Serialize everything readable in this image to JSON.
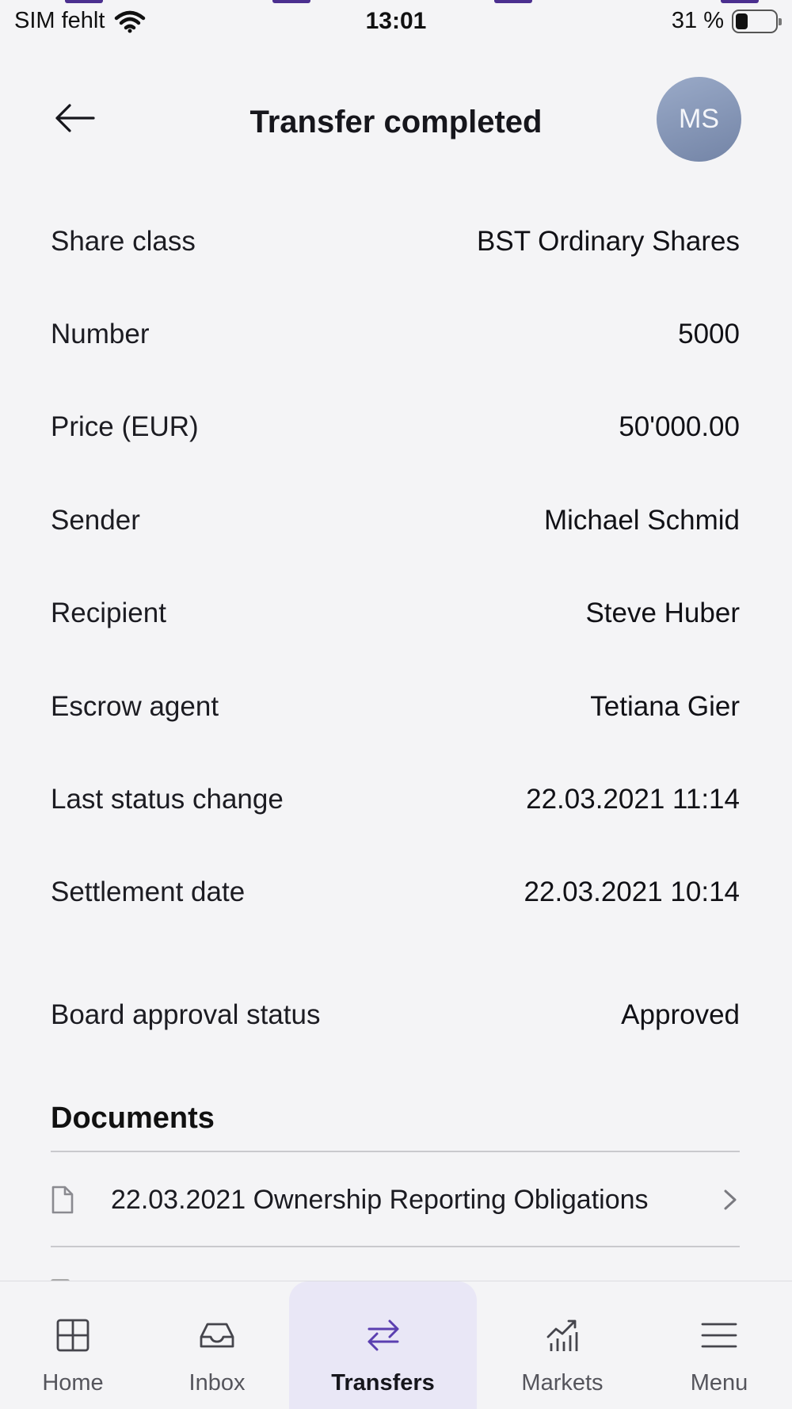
{
  "status_bar": {
    "carrier": "SIM fehlt",
    "time": "13:01",
    "battery_text": "31 %",
    "battery_level": 0.31,
    "wifi_icon": "wifi-icon"
  },
  "header": {
    "title": "Transfer completed",
    "back_icon": "arrow-left-icon",
    "avatar_initials": "MS"
  },
  "details": [
    {
      "label": "Share class",
      "value": "BST Ordinary Shares"
    },
    {
      "label": "Number",
      "value": "5000"
    },
    {
      "label": "Price (EUR)",
      "value": "50'000.00"
    },
    {
      "label": "Sender",
      "value": "Michael Schmid"
    },
    {
      "label": "Recipient",
      "value": "Steve Huber"
    },
    {
      "label": "Escrow agent",
      "value": "Tetiana Gier"
    },
    {
      "label": "Last status change",
      "value": "22.03.2021 11:14"
    },
    {
      "label": "Settlement date",
      "value": "22.03.2021 10:14"
    },
    {
      "label": "Board approval status",
      "value": "Approved"
    }
  ],
  "documents": {
    "title": "Documents",
    "items": [
      {
        "label": "22.03.2021 Ownership Reporting Obligations",
        "icon": "document-icon"
      }
    ]
  },
  "nav": {
    "active": "Transfers",
    "accent_color": "#5b3fb0",
    "items": [
      {
        "label": "Home",
        "icon": "home-grid-icon"
      },
      {
        "label": "Inbox",
        "icon": "inbox-tray-icon"
      },
      {
        "label": "Transfers",
        "icon": "transfer-arrows-icon"
      },
      {
        "label": "Markets",
        "icon": "chart-icon"
      },
      {
        "label": "Menu",
        "icon": "hamburger-menu-icon"
      }
    ]
  }
}
